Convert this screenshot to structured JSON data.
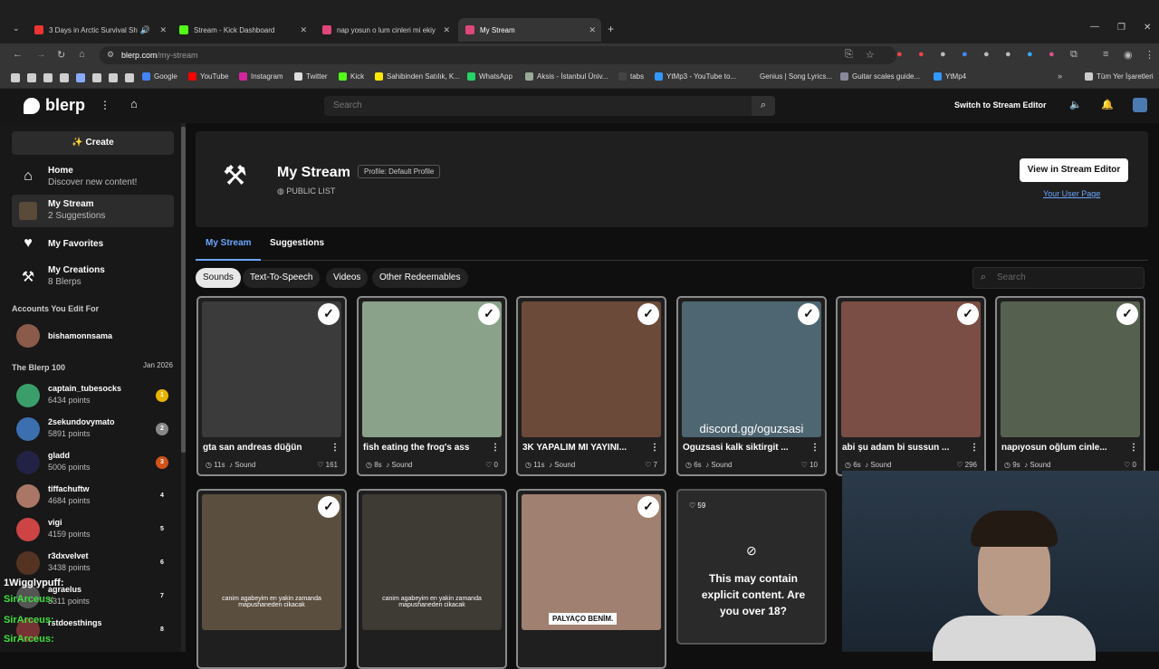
{
  "browser": {
    "tabs": [
      {
        "label": "3 Days in Arctic Survival Sh",
        "favicon": "#e33"
      },
      {
        "label": "Stream - Kick Dashboard",
        "favicon": "#53fc18"
      },
      {
        "label": "nap yosun o lum cinleri mi ekiy",
        "favicon": "#e0457b"
      },
      {
        "label": "My Stream",
        "favicon": "#e0457b"
      }
    ],
    "new_tab": "+",
    "url_host": "blerp.com",
    "url_path": "/my-stream"
  },
  "bookmarks": [
    {
      "label": "Google",
      "color": "#4285f4"
    },
    {
      "label": "YouTube",
      "color": "#f00"
    },
    {
      "label": "Instagram",
      "color": "#d6249f"
    },
    {
      "label": "Twitter",
      "color": "#ddd"
    },
    {
      "label": "Kick",
      "color": "#53fc18"
    },
    {
      "label": "Sahibinden Satılık, K...",
      "color": "#ffe800"
    },
    {
      "label": "WhatsApp",
      "color": "#25d366"
    },
    {
      "label": "Aksis - İstanbul Üniv...",
      "color": "#9a9"
    },
    {
      "label": "tabs",
      "color": "#444"
    },
    {
      "label": "YtMp3 - YouTube to...",
      "color": "#39f"
    },
    {
      "label": "Genius | Song Lyrics...",
      "color": "#ff0"
    },
    {
      "label": "Guitar scales guide...",
      "color": "#889"
    },
    {
      "label": "YtMp4",
      "color": "#39f"
    },
    {
      "label": "Tüm Yer İşaretleri",
      "color": "#ccc"
    }
  ],
  "topbar": {
    "logo": "blerp",
    "search_placeholder": "Search",
    "switch_label": "Switch to Stream Editor"
  },
  "sidebar": {
    "create": "Create",
    "nav": [
      {
        "title": "Home",
        "sub": "Discover new content!"
      },
      {
        "title": "My Stream",
        "sub": "2 Suggestions"
      },
      {
        "title": "My Favorites",
        "sub": ""
      },
      {
        "title": "My Creations",
        "sub": "8 Blerps"
      }
    ],
    "accounts_title": "Accounts You Edit For",
    "account": "bishamonnsama",
    "leaderboard_title": "The Blerp 100",
    "leaderboard_date": "Jan 2026",
    "leaders": [
      {
        "name": "captain_tubesocks",
        "points": "6434 points",
        "rank": "1",
        "rank_color": "#e8b400",
        "avatar": "#3a9e6a"
      },
      {
        "name": "2sekundovymato",
        "points": "5891 points",
        "rank": "2",
        "rank_color": "#888",
        "avatar": "#3b6fb0"
      },
      {
        "name": "gladd",
        "points": "5006 points",
        "rank": "3",
        "rank_color": "#d2521a",
        "avatar": "#224"
      },
      {
        "name": "tiffachuftw",
        "points": "4684 points",
        "rank": "4",
        "rank_color": "transparent",
        "avatar": "#a76"
      },
      {
        "name": "vigi",
        "points": "4159 points",
        "rank": "5",
        "rank_color": "transparent",
        "avatar": "#c44"
      },
      {
        "name": "r3dxvelvet",
        "points": "3438 points",
        "rank": "6",
        "rank_color": "transparent",
        "avatar": "#532"
      },
      {
        "name": "agraelus",
        "points": "3311 points",
        "rank": "7",
        "rank_color": "transparent",
        "avatar": "#555"
      },
      {
        "name": "rstdoesthings",
        "points": "",
        "rank": "8",
        "rank_color": "transparent",
        "avatar": "#733"
      }
    ]
  },
  "header": {
    "title": "My Stream",
    "profile_badge": "Profile: Default Profile",
    "visibility": "PUBLIC LIST",
    "view_button": "View in Stream Editor",
    "user_page_link": "Your User Page"
  },
  "tabs": [
    "My Stream",
    "Suggestions"
  ],
  "filters": [
    "Sounds",
    "Text-To-Speech",
    "Videos",
    "Other Redeemables"
  ],
  "content_search_placeholder": "Search",
  "cards_row1": [
    {
      "name": "gta san andreas düğün",
      "duration": "11s",
      "type": "Sound",
      "likes": "161",
      "thumb": "#3b3b3b"
    },
    {
      "name": "fish eating the frog's ass",
      "duration": "8s",
      "type": "Sound",
      "likes": "0",
      "thumb": "#8aa28a"
    },
    {
      "name": "3K YAPALIM MI YAYINI...",
      "duration": "11s",
      "type": "Sound",
      "likes": "7",
      "thumb": "#6b4a3a"
    },
    {
      "name": "Oguzsasi kalk siktirgit ...",
      "duration": "6s",
      "type": "Sound",
      "likes": "10",
      "thumb": "#4e6672",
      "caption": "discord.gg/oguzsasi"
    },
    {
      "name": "abi şu adam bi sussun ...",
      "duration": "6s",
      "type": "Sound",
      "likes": "296",
      "thumb": "#7a4e44"
    },
    {
      "name": "napıyosun oğlum cinle...",
      "duration": "9s",
      "type": "Sound",
      "likes": "0",
      "thumb": "#56604f"
    }
  ],
  "cards_row2": [
    {
      "thumb": "#5a4e3e",
      "caption": "canim agabeyim en yakin zamanda mapushaneden cikacak"
    },
    {
      "thumb": "#3e3a34",
      "caption": "canim agabeyim en yakin zamanda mapushaneden cikacak"
    },
    {
      "thumb": "#a08070",
      "caption": "PALYAÇO BENİM."
    }
  ],
  "explicit": {
    "likes": "59",
    "message": "This may contain explicit content. Are you over 18?"
  },
  "chat": [
    "1Wigglypuff:",
    "SirArceus:",
    "SirArceus:",
    "SirArceus:"
  ]
}
